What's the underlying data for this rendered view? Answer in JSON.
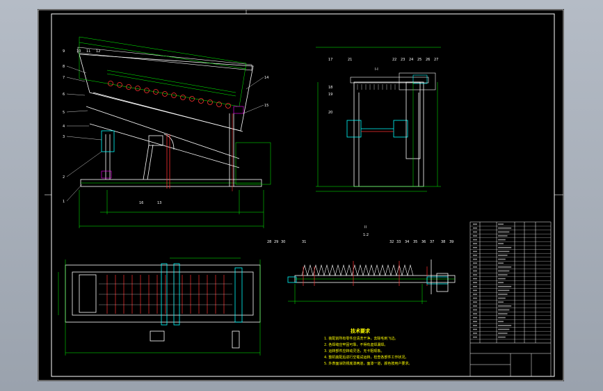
{
  "drawing": {
    "background": "#000000",
    "line_colors": {
      "outline": "#ffffff",
      "dimension": "#00ff00",
      "parts": "#ff3030",
      "highlight": "#00ffff",
      "text_yellow": "#ffff00",
      "magenta": "#ff00ff"
    }
  },
  "side_view": {
    "part_numbers_top": [
      "9",
      "10",
      "11",
      "12"
    ],
    "part_numbers_left": [
      "8",
      "7",
      "6",
      "5",
      "4",
      "3",
      "2",
      "1"
    ],
    "part_numbers_right": [
      "14",
      "15"
    ],
    "part_numbers_bottom": [
      "16",
      "13"
    ]
  },
  "end_view": {
    "section_label": "I-I",
    "part_numbers": [
      "17",
      "18",
      "19",
      "20",
      "21",
      "22",
      "23",
      "24",
      "25",
      "26",
      "27"
    ]
  },
  "detail_view": {
    "label": "II",
    "scale": "1:2",
    "part_numbers": [
      "28",
      "29",
      "30",
      "31",
      "32",
      "33",
      "34",
      "35",
      "36",
      "37",
      "38",
      "39"
    ]
  },
  "technical_requirements": {
    "title": "技术要求",
    "items": [
      "1. 装配前所有零件应清洗干净，去除毛刺飞边。",
      "2. 各焊缝应牢固可靠，不得有虚焊漏焊。",
      "3. 运转部件应转动灵活，无卡阻现象。",
      "4. 整机装配后进行空载试运转，检查各部件工作状况。",
      "5. 外表面涂防锈底漆两道，面漆一道，颜色按用户要求。"
    ]
  }
}
